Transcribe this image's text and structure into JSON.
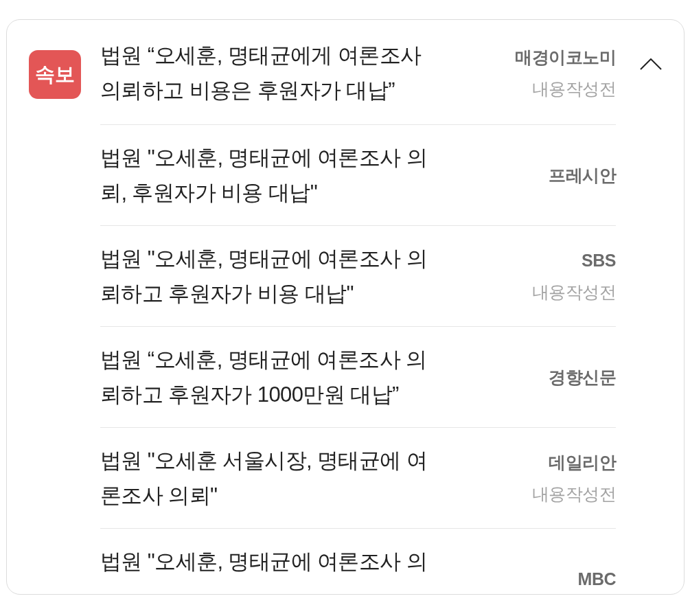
{
  "card": {
    "expanded": true,
    "articles": [
      {
        "badge": "속보",
        "title_lines": [
          "법원 “오세훈, 명태균에게 여론조사",
          "의뢰하고 비용은 후원자가 대납”"
        ],
        "source": "매경이코노미",
        "note": "내용작성전"
      },
      {
        "title_lines": [
          "법원 \"오세훈, 명태균에 여론조사 의",
          "뢰, 후원자가 비용 대납\""
        ],
        "source": "프레시안"
      },
      {
        "title_lines": [
          "법원 \"오세훈, 명태균에 여론조사 의",
          "뢰하고 후원자가 비용 대납\""
        ],
        "source": "SBS",
        "note": "내용작성전"
      },
      {
        "title_lines": [
          "법원 “오세훈, 명태균에 여론조사 의",
          "뢰하고 후원자가 1000만원 대납”"
        ],
        "source": "경향신문"
      },
      {
        "title_lines": [
          "법원 \"오세훈 서울시장, 명태균에 여",
          "론조사 의뢰\""
        ],
        "source": "데일리안",
        "note": "내용작성전"
      },
      {
        "title_lines": [
          "법원 \"오세훈, 명태균에 여론조사 의"
        ],
        "source": "MBC"
      }
    ]
  }
}
